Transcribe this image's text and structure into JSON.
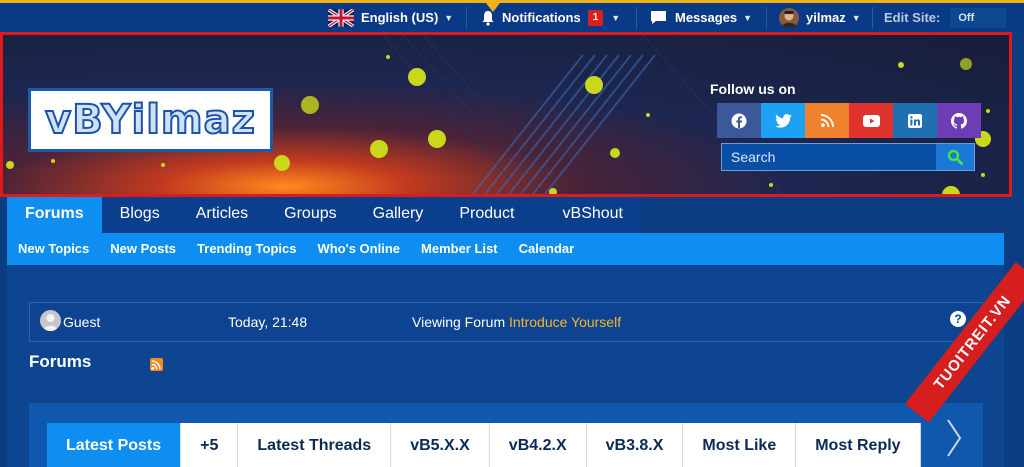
{
  "topbar": {
    "language": "English (US)",
    "notifications_label": "Notifications",
    "notifications_count": "1",
    "messages_label": "Messages",
    "username": "yilmaz",
    "edit_site_label": "Edit Site:",
    "edit_site_value": "Off"
  },
  "banner": {
    "logo_text": "vBYilmaz",
    "follow_label": "Follow us on",
    "socials": [
      "facebook",
      "twitter",
      "rss",
      "youtube",
      "linkedin",
      "github"
    ],
    "social_colors": [
      "#3b5998",
      "#1da1f2",
      "#f0812d",
      "#e0332e",
      "#1f6fb1",
      "#6e3db5"
    ],
    "search_placeholder": "Search"
  },
  "nav": {
    "tabs": [
      "Forums",
      "Blogs",
      "Articles",
      "Groups",
      "Gallery",
      "Product List",
      "vBShout"
    ],
    "sub": [
      "New Topics",
      "New Posts",
      "Trending Topics",
      "Who's Online",
      "Member List",
      "Calendar"
    ]
  },
  "whos_online": {
    "user": "Guest",
    "time": "Today, 21:48",
    "action": "Viewing Forum",
    "forum": "Introduce Yourself"
  },
  "main": {
    "title": "Forums",
    "tabs": [
      "Latest Posts",
      "+5",
      "Latest Threads",
      "vB5.X.X",
      "vB4.2.X",
      "vB3.8.X",
      "Most Like",
      "Most Reply"
    ]
  },
  "watermark": "TUOITREIT.VN"
}
